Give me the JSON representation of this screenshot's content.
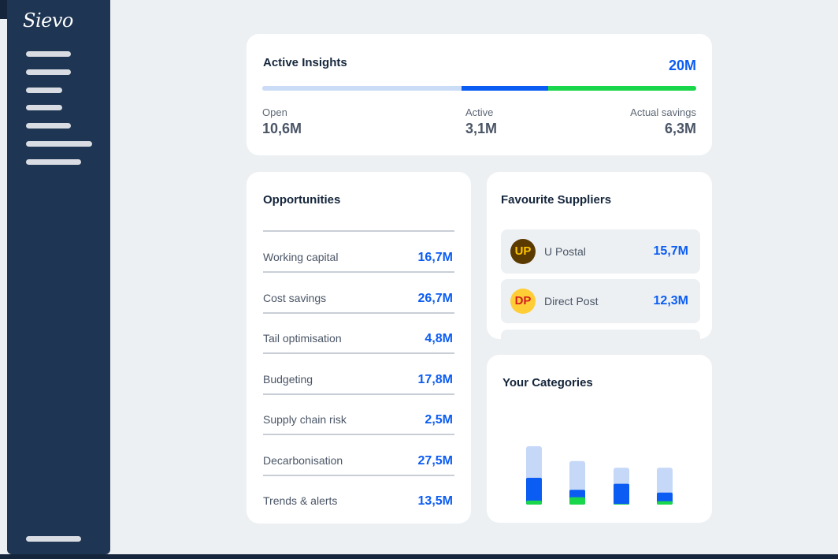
{
  "app": {
    "logo": "Sievo"
  },
  "colors": {
    "accent": "#0b5cf3",
    "savings": "#1ad64a",
    "open": "#cbdcf7",
    "sidebar": "#1e3553"
  },
  "active_insights": {
    "title": "Active Insights",
    "total": "20M",
    "stats": [
      {
        "label": "Open",
        "value": "10,6M"
      },
      {
        "label": "Active",
        "value": "3,1M"
      },
      {
        "label": "Actual savings",
        "value": "6,3M"
      }
    ]
  },
  "opportunities": {
    "title": "Opportunities",
    "items": [
      {
        "label": "Working capital",
        "value": "16,7M"
      },
      {
        "label": "Cost savings",
        "value": "26,7M"
      },
      {
        "label": "Tail optimisation",
        "value": "4,8M"
      },
      {
        "label": "Budgeting",
        "value": "17,8M"
      },
      {
        "label": "Supply chain risk",
        "value": "2,5M"
      },
      {
        "label": "Decarbonisation",
        "value": "27,5M"
      },
      {
        "label": "Trends & alerts",
        "value": "13,5M"
      }
    ]
  },
  "suppliers": {
    "title": "Favourite Suppliers",
    "items": [
      {
        "initials": "UP",
        "name": "U Postal",
        "value": "15,7M",
        "avatar_bg": "#5b3a00",
        "avatar_fg": "#ffc400"
      },
      {
        "initials": "DP",
        "name": "Direct Post",
        "value": "12,3M",
        "avatar_bg": "#ffcd36",
        "avatar_fg": "#d21f1f"
      }
    ]
  },
  "categories": {
    "title": "Your Categories",
    "chart_data": {
      "type": "bar",
      "title": "Your Categories",
      "categories": [
        "",
        "",
        "",
        ""
      ],
      "series": [
        {
          "values": [
            0.87,
            0.65,
            0.55,
            0.55
          ]
        },
        {
          "values": [
            0.4,
            0.22,
            0.31,
            0.18
          ]
        },
        {
          "values": [
            0.06,
            0.11,
            0.01,
            0.05
          ]
        }
      ],
      "ylim": [
        0,
        1
      ]
    }
  }
}
